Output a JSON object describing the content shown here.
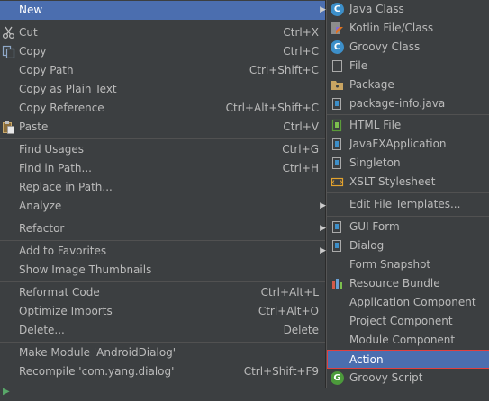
{
  "main_menu": {
    "new": "New",
    "cut": "Cut",
    "cut_sc": "Ctrl+X",
    "copy": "Copy",
    "copy_sc": "Ctrl+C",
    "copy_path": "Copy Path",
    "copy_path_sc": "Ctrl+Shift+C",
    "copy_plain": "Copy as Plain Text",
    "copy_ref": "Copy Reference",
    "copy_ref_sc": "Ctrl+Alt+Shift+C",
    "paste": "Paste",
    "paste_sc": "Ctrl+V",
    "find_usages": "Find Usages",
    "find_usages_sc": "Ctrl+G",
    "find_in_path": "Find in Path...",
    "find_in_path_sc": "Ctrl+H",
    "replace_in_path": "Replace in Path...",
    "analyze": "Analyze",
    "refactor": "Refactor",
    "add_favorites": "Add to Favorites",
    "show_thumbnails": "Show Image Thumbnails",
    "reformat": "Reformat Code",
    "reformat_sc": "Ctrl+Alt+L",
    "optimize": "Optimize Imports",
    "optimize_sc": "Ctrl+Alt+O",
    "delete": "Delete...",
    "delete_sc": "Delete",
    "make_module": "Make Module 'AndroidDialog'",
    "recompile": "Recompile 'com.yang.dialog'",
    "recompile_sc": "Ctrl+Shift+F9"
  },
  "sub_menu": {
    "java_class": "Java Class",
    "kotlin": "Kotlin File/Class",
    "groovy_class": "Groovy Class",
    "file": "File",
    "package": "Package",
    "package_info": "package-info.java",
    "html_file": "HTML File",
    "javafx": "JavaFXApplication",
    "singleton": "Singleton",
    "xslt": "XSLT Stylesheet",
    "edit_templates": "Edit File Templates...",
    "gui_form": "GUI Form",
    "dialog": "Dialog",
    "form_snapshot": "Form Snapshot",
    "resource_bundle": "Resource Bundle",
    "app_component": "Application Component",
    "project_component": "Project Component",
    "module_component": "Module Component",
    "action": "Action",
    "groovy_script": "Groovy Script"
  },
  "colors": {
    "background": "#3c3f41",
    "selection": "#4b6eaf",
    "highlight_outline": "#e04040"
  }
}
